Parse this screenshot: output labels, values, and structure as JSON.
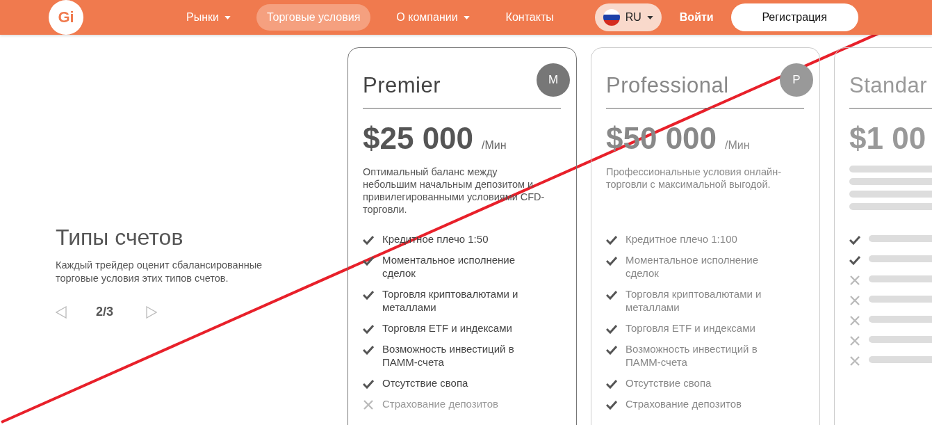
{
  "header": {
    "logo": "Gi",
    "nav": [
      {
        "label": "Рынки",
        "dropdown": true,
        "selected": false
      },
      {
        "label": "Торговые условия",
        "dropdown": false,
        "selected": true
      },
      {
        "label": "О компании",
        "dropdown": true,
        "selected": false
      },
      {
        "label": "Контакты",
        "dropdown": false,
        "selected": false
      }
    ],
    "language": "RU",
    "login": "Войти",
    "register": "Регистрация"
  },
  "intro": {
    "title": "Типы счетов",
    "text": "Каждый трейдер оценит сбалансированные торговые условия этих типов счетов.",
    "pager": "2/3"
  },
  "plans": [
    {
      "name": "Premier",
      "badge": "M",
      "price": "$25 000",
      "period": "/Мин",
      "focused": true,
      "description": "Оптимальный баланс между небольшим начальным депозитом и привилегированными условиями CFD-торговли.",
      "features": [
        {
          "text": "Кредитное плечо 1:50",
          "included": true
        },
        {
          "text": "Моментальное исполнение сделок",
          "included": true
        },
        {
          "text": "Торговля криптовалютами и металлами",
          "included": true
        },
        {
          "text": "Торговля ETF и индексами",
          "included": true
        },
        {
          "text": "Возможность инвестиций в ПАММ-счета",
          "included": true
        },
        {
          "text": "Отсутствие свопа",
          "included": true
        },
        {
          "text": "Страхование депозитов",
          "included": false
        }
      ]
    },
    {
      "name": "Professional",
      "badge": "P",
      "price": "$50 000",
      "period": "/Мин",
      "focused": false,
      "description": "Профессиональные условия онлайн-торговли с максимальной выгодой.",
      "features": [
        {
          "text": "Кредитное плечо 1:100",
          "included": true
        },
        {
          "text": "Моментальное исполнение сделок",
          "included": true
        },
        {
          "text": "Торговля криптовалютами и металлами",
          "included": true
        },
        {
          "text": "Торговля ETF и индексами",
          "included": true
        },
        {
          "text": "Возможность инвестиций в ПАММ-счета",
          "included": true
        },
        {
          "text": "Отсутствие свопа",
          "included": true
        },
        {
          "text": "Страхование депозитов",
          "included": true
        }
      ]
    },
    {
      "name": "Standar",
      "price": "$1 00",
      "focused": false,
      "features": [
        {
          "included": true
        },
        {
          "included": true
        },
        {
          "included": false
        },
        {
          "included": false
        },
        {
          "included": false
        },
        {
          "included": false
        },
        {
          "included": false
        }
      ]
    }
  ]
}
